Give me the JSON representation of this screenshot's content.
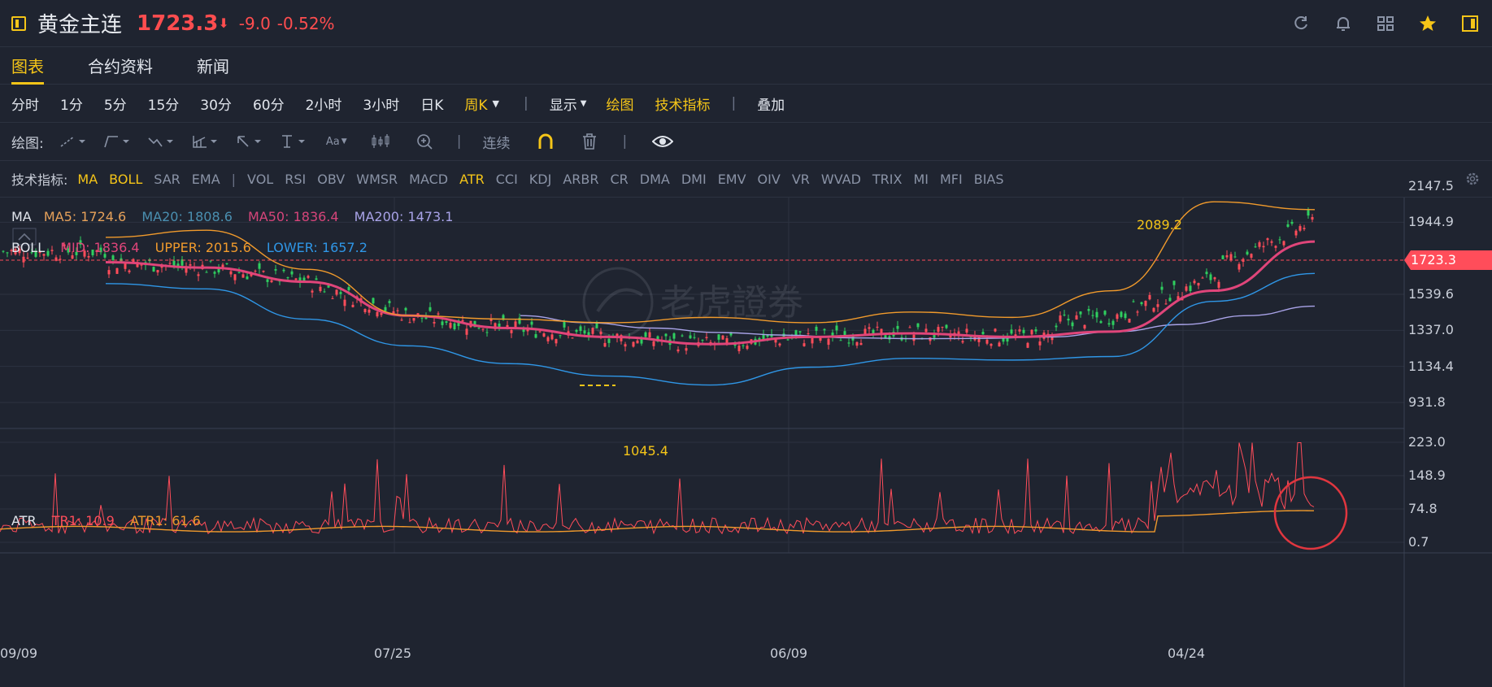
{
  "header": {
    "name": "黄金主连",
    "price": "1723.3",
    "arrow": "⬇",
    "change": "-9.0",
    "change_pct": "-0.52%",
    "icons": [
      "refresh-icon",
      "bell-icon",
      "grid-icon",
      "star-icon",
      "panel-icon"
    ]
  },
  "tabs": [
    "图表",
    "合约资料",
    "新闻"
  ],
  "periods": [
    "分时",
    "1分",
    "5分",
    "15分",
    "30分",
    "60分",
    "2小时",
    "3小时",
    "日K",
    "周K"
  ],
  "period_extra": {
    "display": "显示",
    "draw": "绘图",
    "tech": "技术指标",
    "overlay": "叠加"
  },
  "drawtools": {
    "label": "绘图:",
    "continuous": "连续"
  },
  "indicators": {
    "label": "技术指标:",
    "main": [
      "MA",
      "BOLL",
      "SAR",
      "EMA"
    ],
    "sub": [
      "VOL",
      "RSI",
      "OBV",
      "WMSR",
      "MACD",
      "ATR",
      "CCI",
      "KDJ",
      "ARBR",
      "CR",
      "DMA",
      "DMI",
      "EMV",
      "OIV",
      "VR",
      "WVAD",
      "TRIX",
      "MI",
      "MFI",
      "BIAS"
    ]
  },
  "legend": {
    "ma_label": "MA",
    "ma5": "MA5: 1724.6",
    "ma20": "MA20: 1808.6",
    "ma50": "MA50: 1836.4",
    "ma200": "MA200: 1473.1",
    "boll_label": "BOLL",
    "mid": "MID: 1836.4",
    "upper": "UPPER: 2015.6",
    "lower": "LOWER: 1657.2",
    "atr_label": "ATR",
    "tr1": "TR1: 10.9",
    "atr1": "ATR1: 61.6"
  },
  "colors": {
    "ma5": "#e6a15a",
    "ma20": "#4a8fb0",
    "ma50": "#d6457a",
    "ma200": "#a9a3e8",
    "upper": "#f09a2c",
    "lower": "#2f96e6",
    "mid": "#e0457a",
    "up": "#2fcf5f",
    "down": "#ff4d5a",
    "accent": "#f5c518"
  },
  "chart_data": {
    "type": "line",
    "price_axis": [
      "2147.5",
      "1944.9",
      "1539.6",
      "1337.0",
      "1134.4",
      "931.8"
    ],
    "atr_axis": [
      "223.0",
      "148.9",
      "74.8",
      "0.7"
    ],
    "x_labels": [
      "09/09",
      "07/25",
      "06/09",
      "04/24"
    ],
    "current_price": "1723.3",
    "annotations": {
      "high": "2089.2",
      "low": "1045.4"
    },
    "ylim": [
      931.8,
      2147.5
    ],
    "atr_ylim": [
      0.7,
      223.0
    ],
    "series": [
      {
        "name": "MA200",
        "values": [
          1420,
          1380,
          1350,
          1325,
          1310,
          1295,
          1290,
          1292,
          1300,
          1330,
          1370,
          1420,
          1473
        ]
      },
      {
        "name": "MID",
        "values": [
          1720,
          1690,
          1610,
          1420,
          1350,
          1300,
          1260,
          1300,
          1320,
          1300,
          1330,
          1560,
          1836
        ]
      },
      {
        "name": "UPPER",
        "values": [
          1860,
          1900,
          1680,
          1420,
          1400,
          1380,
          1410,
          1380,
          1440,
          1410,
          1560,
          2060,
          2016
        ]
      },
      {
        "name": "LOWER",
        "values": [
          1600,
          1570,
          1400,
          1250,
          1150,
          1080,
          1030,
          1130,
          1180,
          1170,
          1190,
          1500,
          1657
        ]
      }
    ]
  }
}
